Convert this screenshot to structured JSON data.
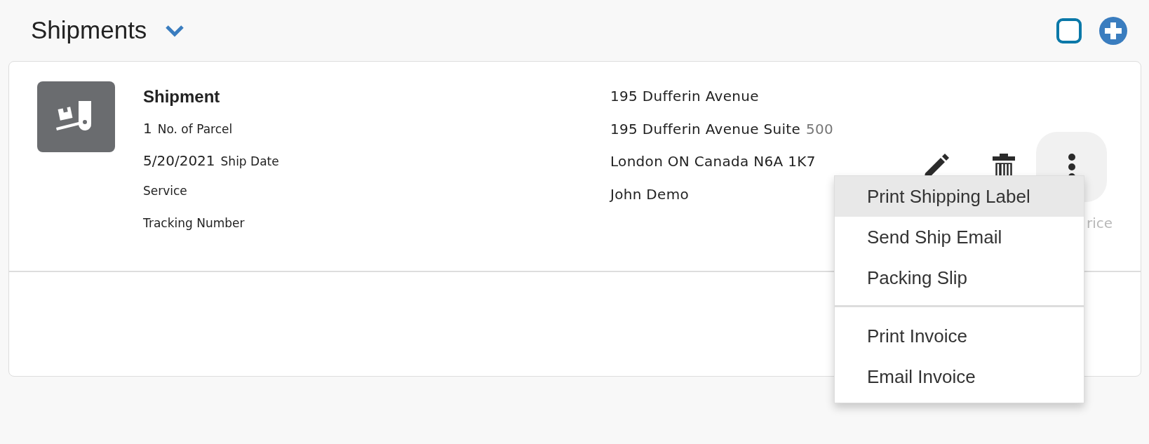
{
  "header": {
    "title": "Shipments",
    "expanded": false,
    "select_all": {
      "checked": false
    }
  },
  "shipment": {
    "title": "Shipment",
    "details": [
      {
        "value": "1",
        "label": "No. of Parcel"
      },
      {
        "value": "5/20/2021",
        "label": "Ship Date"
      },
      {
        "label": "Service"
      },
      {
        "label": "Tracking Number"
      }
    ],
    "address": [
      {
        "text": "195 Dufferin Avenue"
      },
      {
        "text": "195 Dufferin Avenue Suite",
        "muted": "500"
      },
      {
        "text": "London ON Canada N6A 1K7"
      },
      {
        "text": "John Demo"
      }
    ],
    "hidden_label": "rice"
  },
  "menu": {
    "open": true,
    "groups": [
      [
        {
          "label": "Print Shipping Label",
          "selected": true
        },
        {
          "label": "Send Ship Email",
          "selected": false
        },
        {
          "label": "Packing Slip",
          "selected": false
        }
      ],
      [
        {
          "label": "Print Invoice",
          "selected": false
        },
        {
          "label": "Email Invoice",
          "selected": false
        }
      ]
    ]
  }
}
